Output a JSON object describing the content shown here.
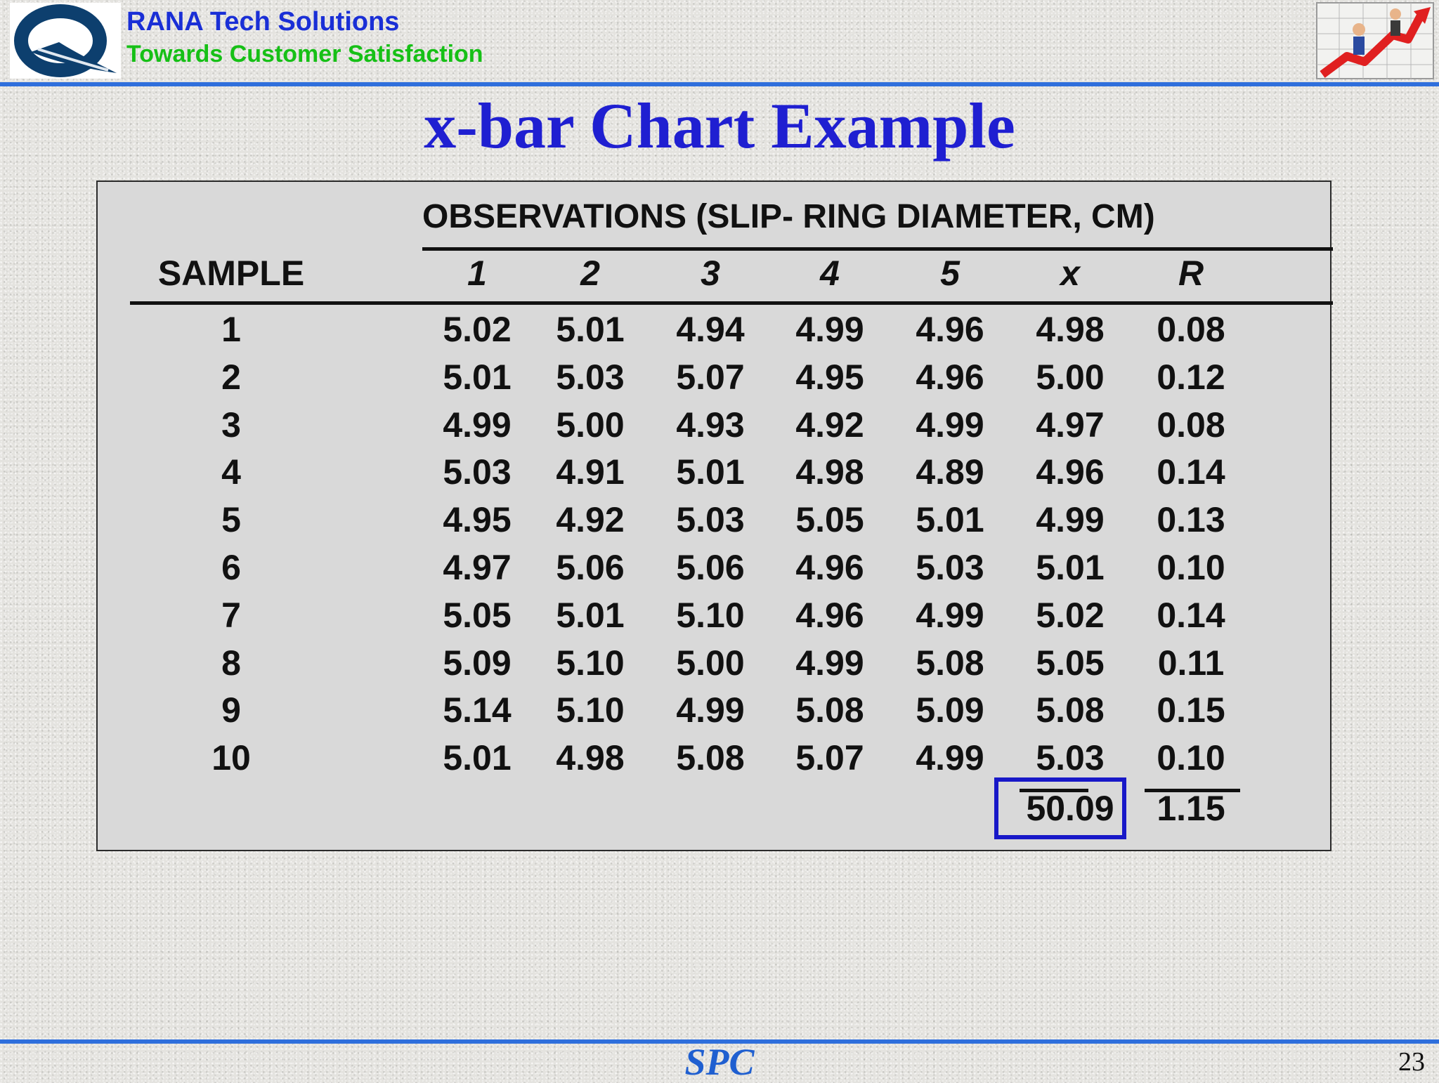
{
  "header": {
    "brand_name": "RANA Tech Solutions",
    "brand_tagline": "Towards Customer Satisfaction"
  },
  "slide": {
    "title": "x-bar Chart Example",
    "footer_label": "SPC",
    "page_number": "23"
  },
  "table": {
    "group_header": "OBSERVATIONS (SLIP- RING DIAMETER, CM)",
    "sample_header": "SAMPLE",
    "column_headers": [
      "1",
      "2",
      "3",
      "4",
      "5",
      "x",
      "R"
    ],
    "rows": [
      [
        "1",
        "5.02",
        "5.01",
        "4.94",
        "4.99",
        "4.96",
        "4.98",
        "0.08"
      ],
      [
        "2",
        "5.01",
        "5.03",
        "5.07",
        "4.95",
        "4.96",
        "5.00",
        "0.12"
      ],
      [
        "3",
        "4.99",
        "5.00",
        "4.93",
        "4.92",
        "4.99",
        "4.97",
        "0.08"
      ],
      [
        "4",
        "5.03",
        "4.91",
        "5.01",
        "4.98",
        "4.89",
        "4.96",
        "0.14"
      ],
      [
        "5",
        "4.95",
        "4.92",
        "5.03",
        "5.05",
        "5.01",
        "4.99",
        "0.13"
      ],
      [
        "6",
        "4.97",
        "5.06",
        "5.06",
        "4.96",
        "5.03",
        "5.01",
        "0.10"
      ],
      [
        "7",
        "5.05",
        "5.01",
        "5.10",
        "4.96",
        "4.99",
        "5.02",
        "0.14"
      ],
      [
        "8",
        "5.09",
        "5.10",
        "5.00",
        "4.99",
        "5.08",
        "5.05",
        "0.11"
      ],
      [
        "9",
        "5.14",
        "5.10",
        "4.99",
        "5.08",
        "5.09",
        "5.08",
        "0.15"
      ],
      [
        "10",
        "5.01",
        "4.98",
        "5.08",
        "5.07",
        "4.99",
        "5.03",
        "0.10"
      ]
    ],
    "totals": {
      "x_sum": "50.09",
      "r_sum": "1.15"
    }
  },
  "colors": {
    "brand_blue": "#1a2fd6",
    "tagline_green": "#16c016",
    "rule_blue": "#2f6fdc",
    "title_blue": "#1f1fd1",
    "highlight_blue": "#1818c8"
  }
}
